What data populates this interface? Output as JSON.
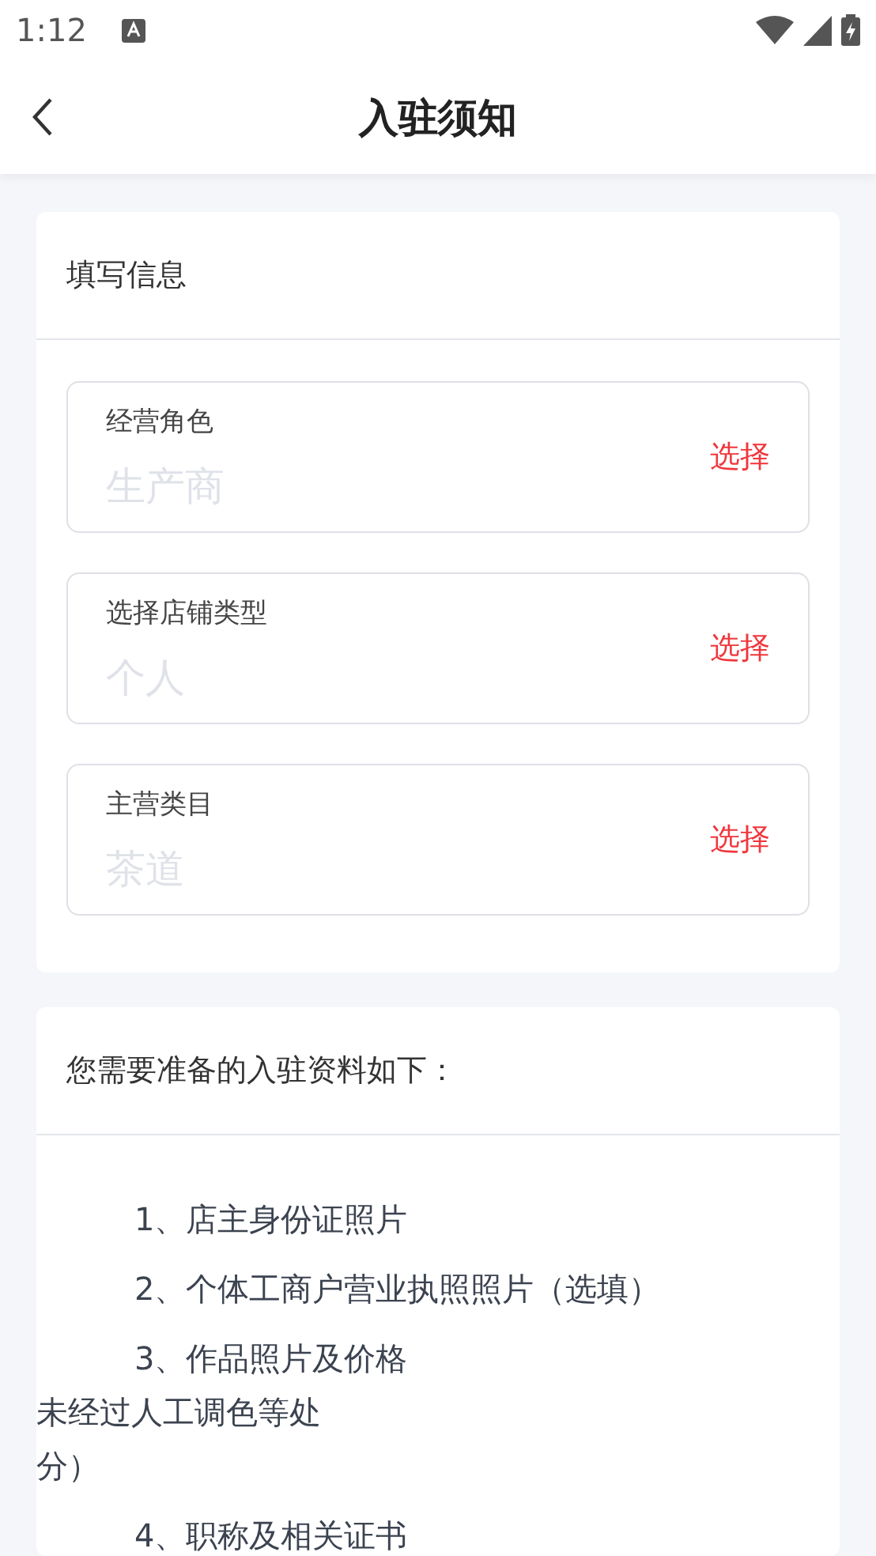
{
  "status_bar": {
    "time": "1:12"
  },
  "header": {
    "title": "入驻须知"
  },
  "form_card": {
    "title": "填写信息",
    "fields": [
      {
        "label": "经营角色",
        "placeholder": "生产商",
        "action": "选择"
      },
      {
        "label": "选择店铺类型",
        "placeholder": "个人",
        "action": "选择"
      },
      {
        "label": "主营类目",
        "placeholder": "茶道",
        "action": "选择"
      }
    ]
  },
  "requirements_card": {
    "title": "您需要准备的入驻资料如下：",
    "items": [
      {
        "lines": [
          "1、店主身份证照片"
        ]
      },
      {
        "lines": [
          "2、个体工商户营业执照照片（选填）"
        ]
      },
      {
        "lines": [
          "3、作品照片及价格",
          "未经过人工调色等处",
          "分）"
        ]
      },
      {
        "lines": [
          "4、职称及相关证书"
        ]
      }
    ]
  }
}
